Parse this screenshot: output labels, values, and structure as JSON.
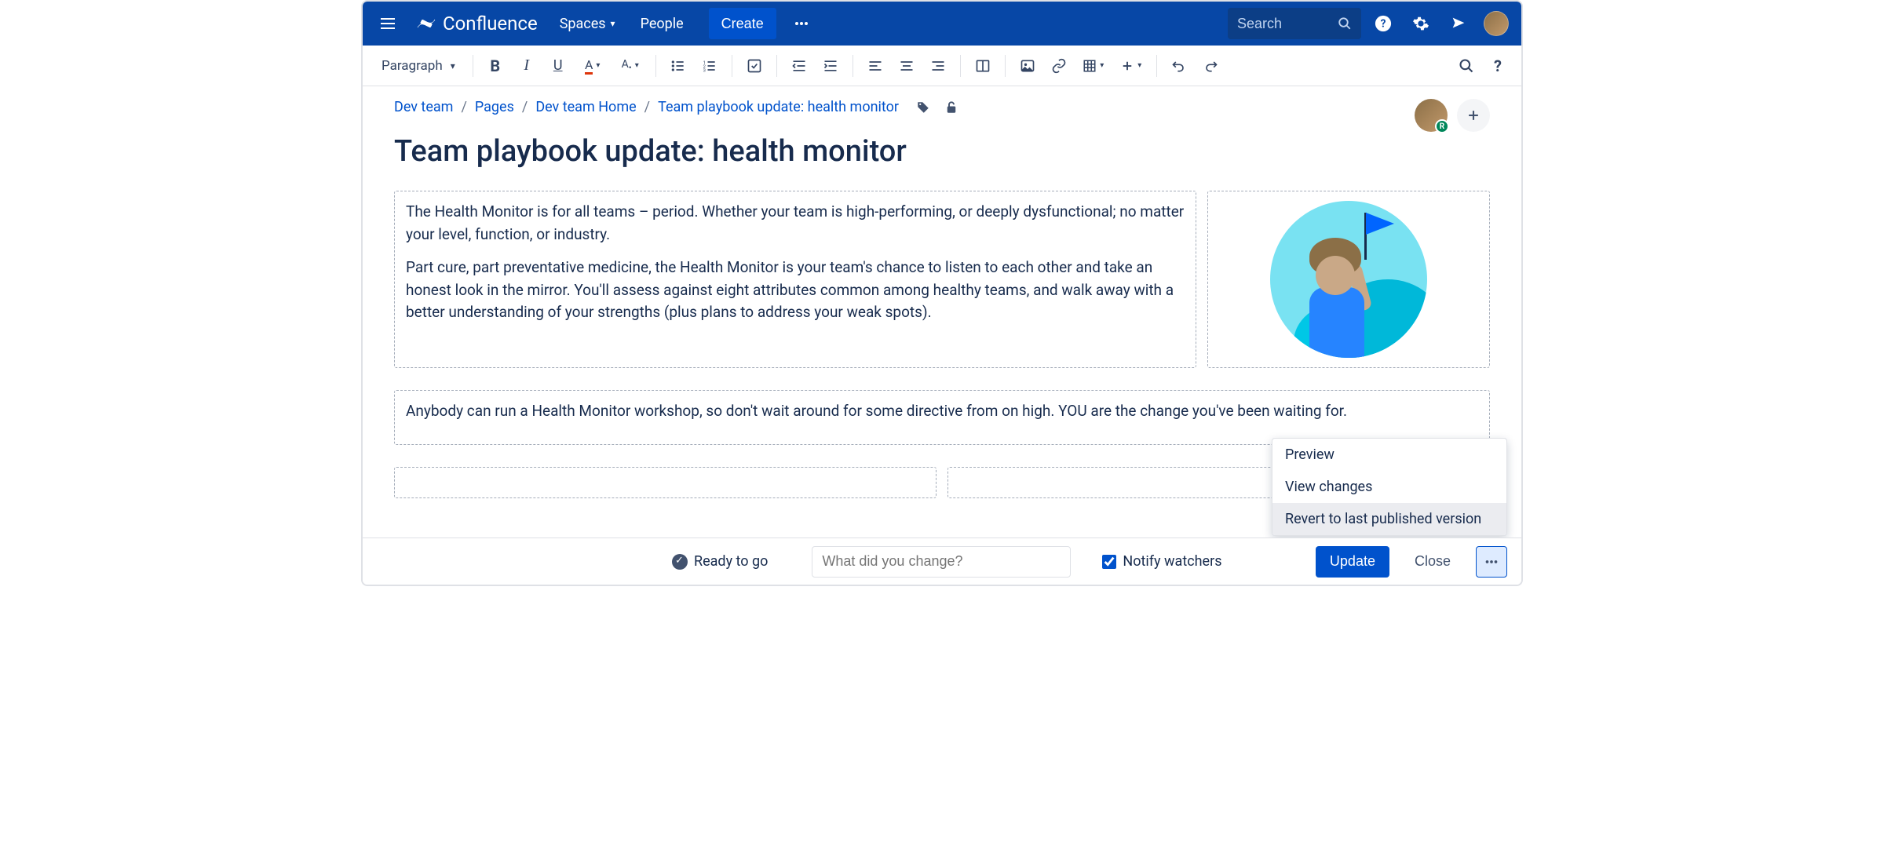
{
  "nav": {
    "product": "Confluence",
    "spaces": "Spaces",
    "people": "People",
    "create": "Create",
    "search_placeholder": "Search"
  },
  "toolbar": {
    "style_select": "Paragraph"
  },
  "breadcrumb": {
    "items": [
      "Dev team",
      "Pages",
      "Dev team Home",
      "Team playbook update: health monitor"
    ]
  },
  "page": {
    "title": "Team playbook update: health monitor",
    "para1": "The Health Monitor is for all teams – period. Whether your team is high-performing, or deeply dysfunctional; no matter your level, function, or industry.",
    "para2": "Part cure, part preventative medicine, the Health Monitor is your team's chance to listen to each other and take an honest look in the mirror. You'll assess against eight attributes common among healthy teams, and walk away with a better understanding of your strengths (plus plans to address your weak spots).",
    "para3": "Anybody can run a Health Monitor workshop, so don't wait around for some directive from on high. YOU are the change you've been waiting for."
  },
  "footer": {
    "status": "Ready to go",
    "change_placeholder": "What did you change?",
    "notify": "Notify watchers",
    "update": "Update",
    "close": "Close"
  },
  "menu": {
    "preview": "Preview",
    "view_changes": "View changes",
    "revert": "Revert to last published version"
  },
  "collab_badge": "R"
}
